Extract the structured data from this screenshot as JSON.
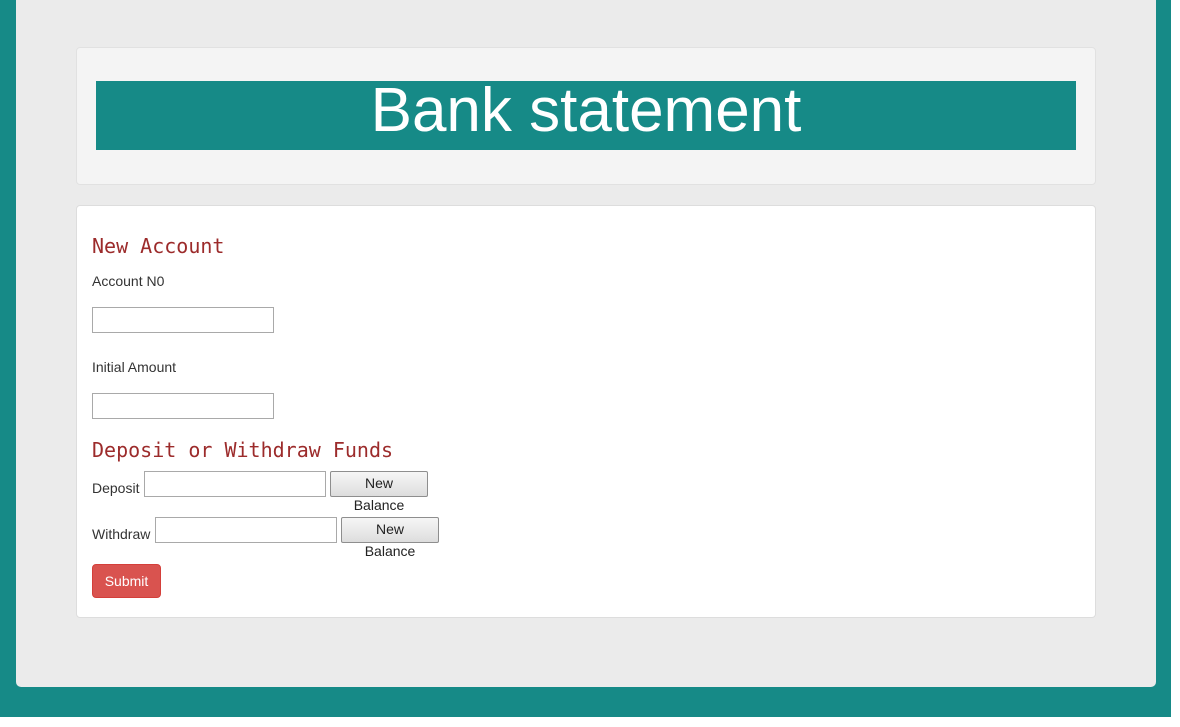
{
  "header": {
    "title": "Bank statement"
  },
  "new_account": {
    "heading": "New Account",
    "account_no_label": "Account N0",
    "account_no_value": "",
    "initial_amount_label": "Initial Amount",
    "initial_amount_value": ""
  },
  "funds": {
    "heading": "Deposit or Withdraw Funds",
    "deposit_label": "Deposit",
    "deposit_value": "",
    "deposit_button": "New Balance",
    "withdraw_label": "Withdraw",
    "withdraw_value": "",
    "withdraw_button": "New Balance"
  },
  "actions": {
    "submit_label": "Submit"
  },
  "colors": {
    "accent": "#168a87",
    "heading": "#9c2b2b",
    "danger": "#d9534f"
  }
}
